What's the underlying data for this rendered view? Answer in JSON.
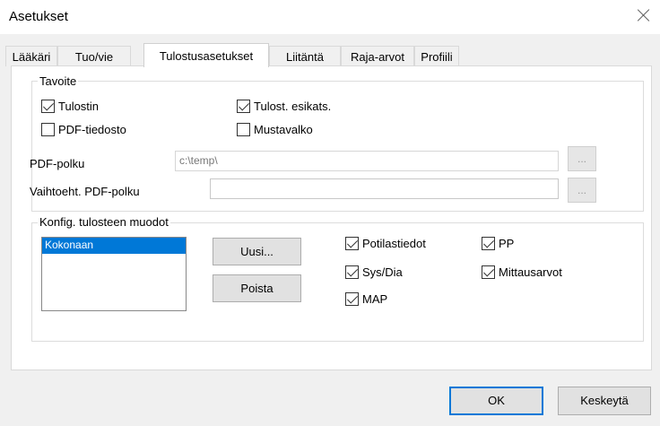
{
  "window": {
    "title": "Asetukset"
  },
  "tabs": [
    {
      "label": "Lääkäri"
    },
    {
      "label": "Tuo/vie"
    },
    {
      "label": "Tulostusasetukset"
    },
    {
      "label": "Liitäntä"
    },
    {
      "label": "Raja-arvot"
    },
    {
      "label": "Profiili"
    }
  ],
  "active_tab": "Tulostusasetukset",
  "tavoite": {
    "label": "Tavoite",
    "tulostin": {
      "label": "Tulostin",
      "checked": true
    },
    "esikats": {
      "label": "Tulost. esikats.",
      "checked": true
    },
    "pdf_tiedosto": {
      "label": "PDF-tiedosto",
      "checked": false
    },
    "mustavalko": {
      "label": "Mustavalko",
      "checked": false
    },
    "pdf_polku": {
      "label": "PDF-polku",
      "value": "c:\\temp\\"
    },
    "vaihtoeht_polku": {
      "label": "Vaihtoeht. PDF-polku",
      "value": ""
    },
    "browse_label": "..."
  },
  "konfig": {
    "label": "Konfig. tulosteen muodot",
    "list_items": [
      "Kokonaan"
    ],
    "uusi_label": "Uusi...",
    "poista_label": "Poista",
    "options": {
      "potilastiedot": {
        "label": "Potilastiedot",
        "checked": true
      },
      "pp": {
        "label": "PP",
        "checked": true
      },
      "sys_dia": {
        "label": "Sys/Dia",
        "checked": true
      },
      "mittausarvot": {
        "label": "Mittausarvot",
        "checked": true
      },
      "map": {
        "label": "MAP",
        "checked": true
      }
    }
  },
  "footer": {
    "ok_label": "OK",
    "cancel_label": "Keskeytä"
  }
}
